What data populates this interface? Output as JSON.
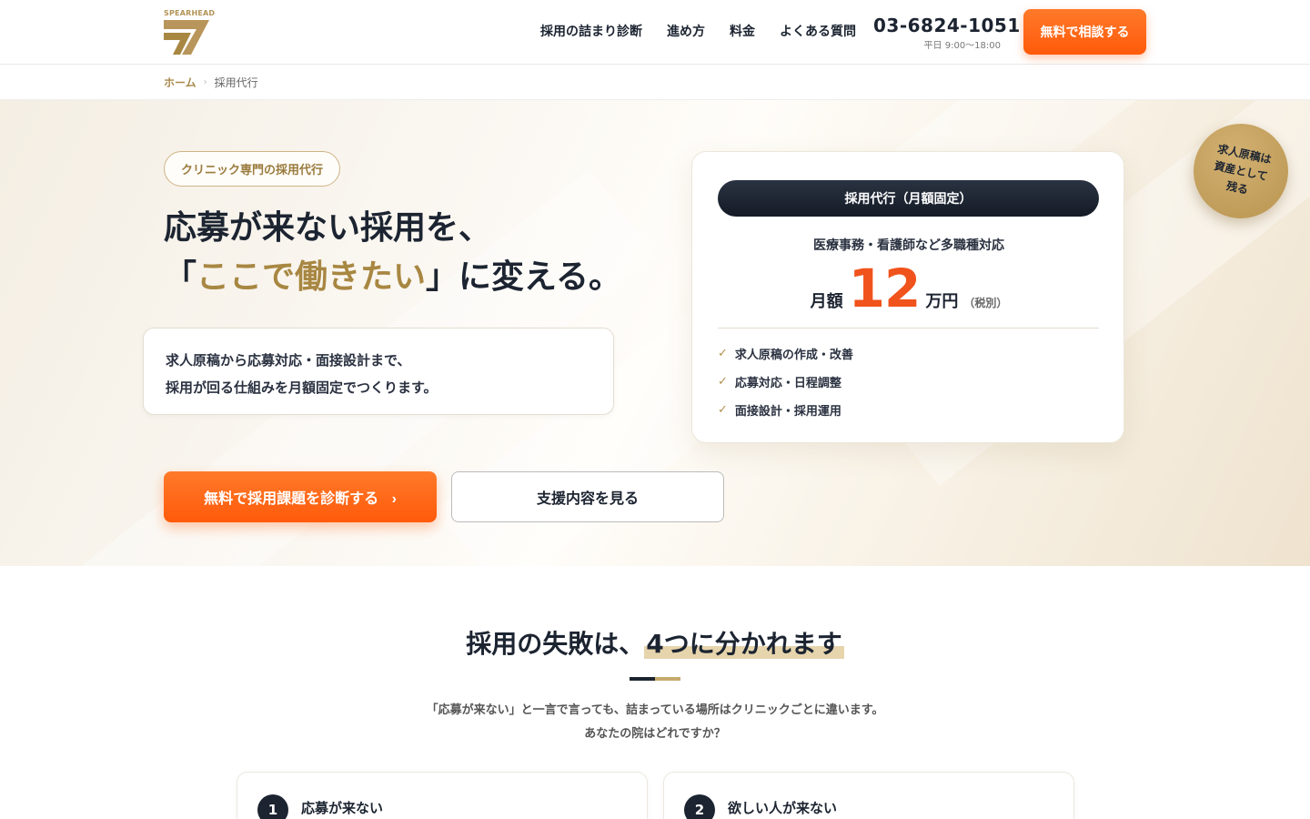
{
  "brand": {
    "logo_text": "SPEARHEAD",
    "accent": "#a88742",
    "cta_color": "#ff5a0a"
  },
  "nav": {
    "items": [
      "採用の詰まり診断",
      "進め方",
      "料金",
      "よくある質問"
    ],
    "phone": "03-6824-1051",
    "hours": "平日 9:00〜18:00",
    "cta": "無料で相談する"
  },
  "breadcrumb": {
    "home": "ホーム",
    "sep": "›",
    "current": "採用代行"
  },
  "hero": {
    "badge": "クリニック専門の採用代行",
    "title_line1": "応募が来ない採用を、",
    "title_line2_pre": "「",
    "title_line2_gold": "ここで働きたい",
    "title_line2_post": "」に変える。",
    "desc_line1": "求人原稿から応募対応・面接設計まで、",
    "desc_line2": "採用が回る仕組みを月額固定でつくります。",
    "primary_cta": "無料で採用課題を診断する",
    "primary_cta_arrow": "›",
    "secondary_cta": "支援内容を見る"
  },
  "price_card": {
    "pill": "採用代行（月額固定）",
    "sub": "医療事務・看護師など多職種対応",
    "pre": "月額",
    "amount": "12",
    "unit": "万円",
    "tax": "（税別）",
    "features": [
      "求人原稿の作成・改善",
      "応募対応・日程調整",
      "面接設計・採用運用"
    ]
  },
  "seal": {
    "line1": "求人原稿は",
    "line2": "資産として",
    "line3": "残る"
  },
  "section_failures": {
    "title_pre": "採用の失敗は、",
    "title_hl": "4つに分かれます",
    "desc_line1": "「応募が来ない」と一言で言っても、詰まっている場所はクリニックごとに違います。",
    "desc_line2": "あなたの院はどれですか？",
    "cards": [
      {
        "num": "1",
        "label": "応募が来ない"
      },
      {
        "num": "2",
        "label": "欲しい人が来ない"
      }
    ]
  }
}
